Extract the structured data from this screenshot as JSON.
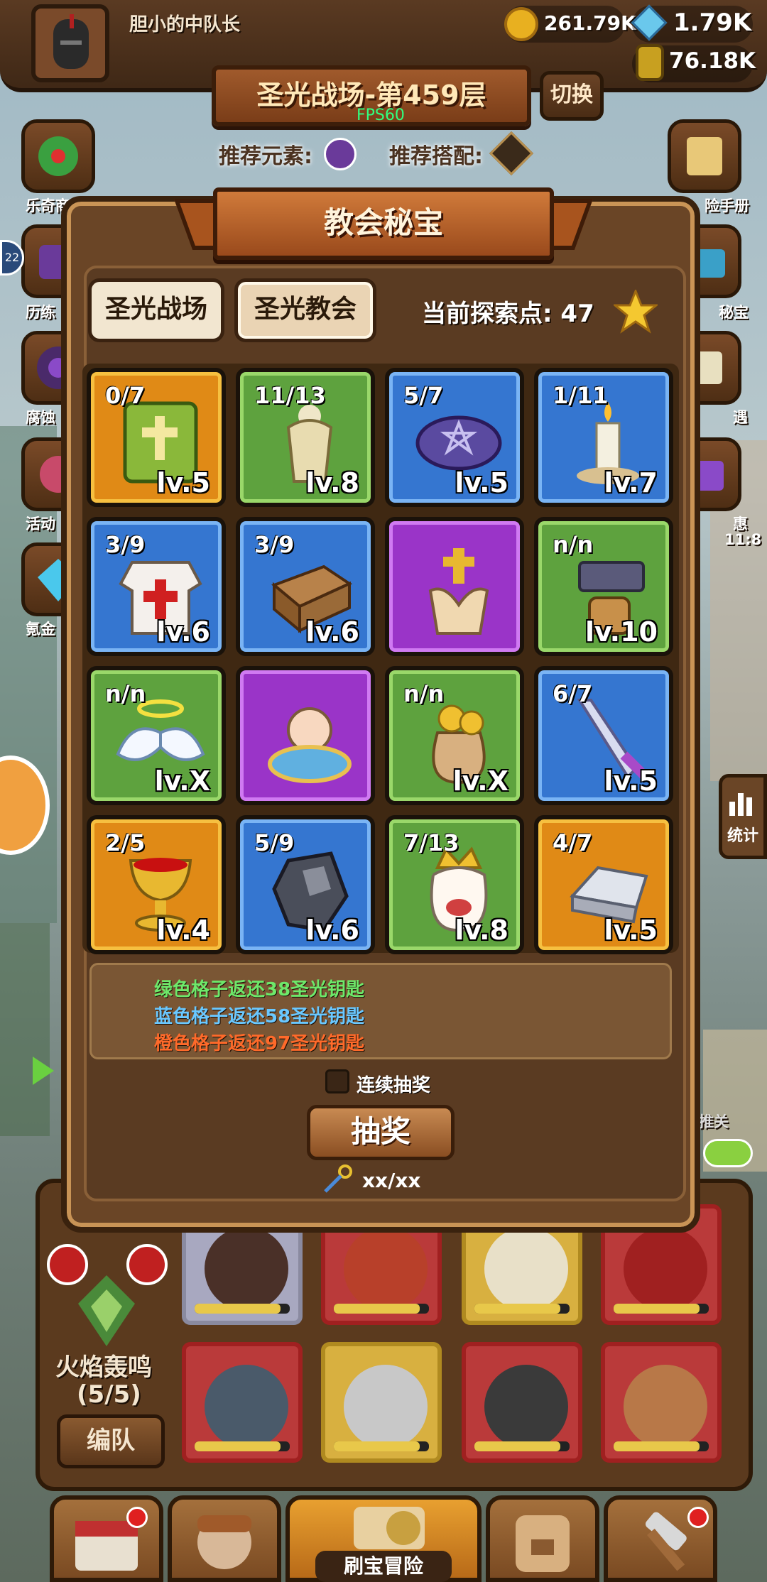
{
  "player": {
    "name": "胆小的中队长"
  },
  "resources": {
    "gold": "261.79K",
    "gems": "1.79K",
    "potion": "76.18K"
  },
  "stage": {
    "title": "圣光战场-第459层",
    "fps": "FPS60",
    "switch_label": "切换"
  },
  "recommend": {
    "element_label": "推荐元素:",
    "combo_label": "推荐搭配:"
  },
  "side_left": [
    "乐奇商",
    "历练",
    "腐蚀",
    "活动",
    "氪金"
  ],
  "side_right": [
    "险手册",
    "秘宝",
    "遇",
    "惠",
    "统计"
  ],
  "side_right_timer": "11:8",
  "left_badge": "22",
  "modal": {
    "title": "教会秘宝",
    "tabs": [
      {
        "label": "圣光战场",
        "active": false
      },
      {
        "label": "圣光教会",
        "active": true
      }
    ],
    "explore_label": "当前探索点: 47",
    "cells": [
      {
        "color": "orange",
        "count": "0/7",
        "level": "lv.5",
        "icon": "bible-icon"
      },
      {
        "color": "green",
        "count": "11/13",
        "level": "lv.8",
        "icon": "angel-statue-icon"
      },
      {
        "color": "blue",
        "count": "5/7",
        "level": "lv.5",
        "icon": "magic-circle-icon"
      },
      {
        "color": "blue",
        "count": "1/11",
        "level": "lv.7",
        "icon": "candle-icon"
      },
      {
        "color": "blue",
        "count": "3/9",
        "level": "lv.6",
        "icon": "holy-robe-icon"
      },
      {
        "color": "blue",
        "count": "3/9",
        "level": "lv.6",
        "icon": "wood-block-icon"
      },
      {
        "color": "purple",
        "count": "",
        "level": "",
        "icon": "praying-hands-icon"
      },
      {
        "color": "green",
        "count": "n/n",
        "level": "lv.10",
        "icon": "anvil-icon"
      },
      {
        "color": "green",
        "count": "n/n",
        "level": "lv.X",
        "icon": "angel-wings-icon"
      },
      {
        "color": "purple",
        "count": "",
        "level": "",
        "icon": "baby-bath-icon"
      },
      {
        "color": "green",
        "count": "n/n",
        "level": "lv.X",
        "icon": "coin-bag-icon"
      },
      {
        "color": "blue",
        "count": "6/7",
        "level": "lv.5",
        "icon": "sword-icon"
      },
      {
        "color": "orange",
        "count": "2/5",
        "level": "lv.4",
        "icon": "grail-icon"
      },
      {
        "color": "blue",
        "count": "5/9",
        "level": "lv.6",
        "icon": "ore-icon"
      },
      {
        "color": "green",
        "count": "7/13",
        "level": "lv.8",
        "icon": "king-ghost-icon"
      },
      {
        "color": "orange",
        "count": "4/7",
        "level": "lv.5",
        "icon": "silver-ingot-icon"
      }
    ],
    "info_lines": [
      {
        "text": "绿色格子返还38圣光钥匙",
        "color": "#6ee86a"
      },
      {
        "text": "蓝色格子返还58圣光钥匙",
        "color": "#6ac8ff"
      },
      {
        "text": "橙色格子返还97圣光钥匙",
        "color": "#ff6a2a"
      }
    ],
    "continuous_label": "连续抽奖",
    "draw_label": "抽奖",
    "key_count": "xx/xx"
  },
  "team": {
    "name": "火焰轰鸣",
    "count": "(5/5)",
    "edit_label": "编队"
  },
  "bottom_nav": {
    "center_label": "刷宝冒险",
    "side_label": "推关"
  },
  "colors": {
    "orange": "#e08a16",
    "green": "#5ea23e",
    "blue": "#3576d0",
    "purple": "#9a34c8"
  }
}
